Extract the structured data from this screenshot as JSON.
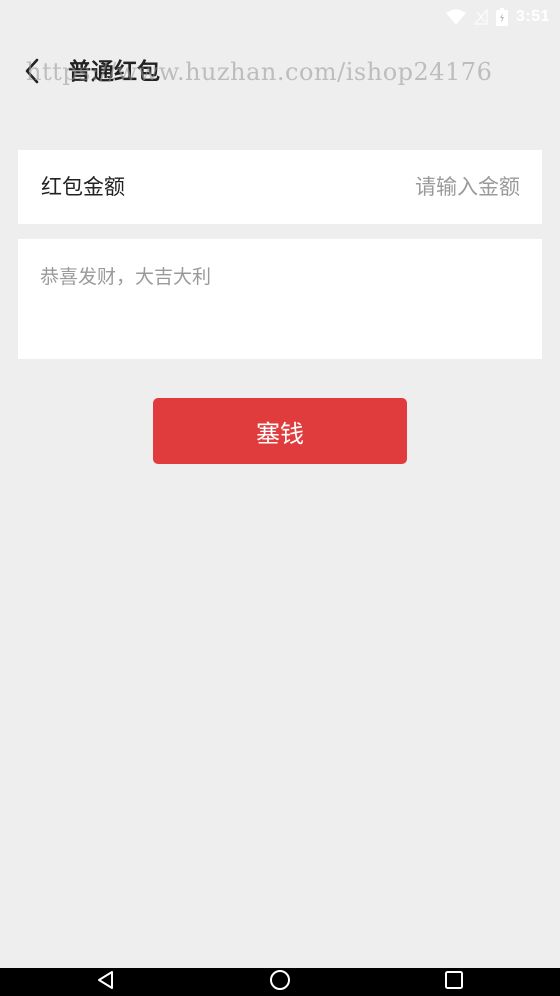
{
  "status_bar": {
    "time": "3:51",
    "icons": [
      "wifi-icon",
      "signal-icon",
      "battery-icon"
    ],
    "icon_color": "#ffffff"
  },
  "header": {
    "title": "普通红包",
    "back_icon": "chevron-left-icon"
  },
  "watermark": "https://www.huzhan.com/ishop24176",
  "form": {
    "amount_label": "红包金额",
    "amount_placeholder": "请输入金额",
    "amount_value": "",
    "greeting_placeholder": "恭喜发财，大吉大利",
    "greeting_value": ""
  },
  "actions": {
    "submit_label": "塞钱",
    "submit_color": "#e03c3e"
  },
  "nav_bar": {
    "buttons": [
      "back-triangle-icon",
      "home-circle-icon",
      "recents-square-icon"
    ]
  },
  "colors": {
    "background": "#eeeeee",
    "card": "#ffffff",
    "placeholder": "#9a9a9a",
    "text": "#222222"
  }
}
